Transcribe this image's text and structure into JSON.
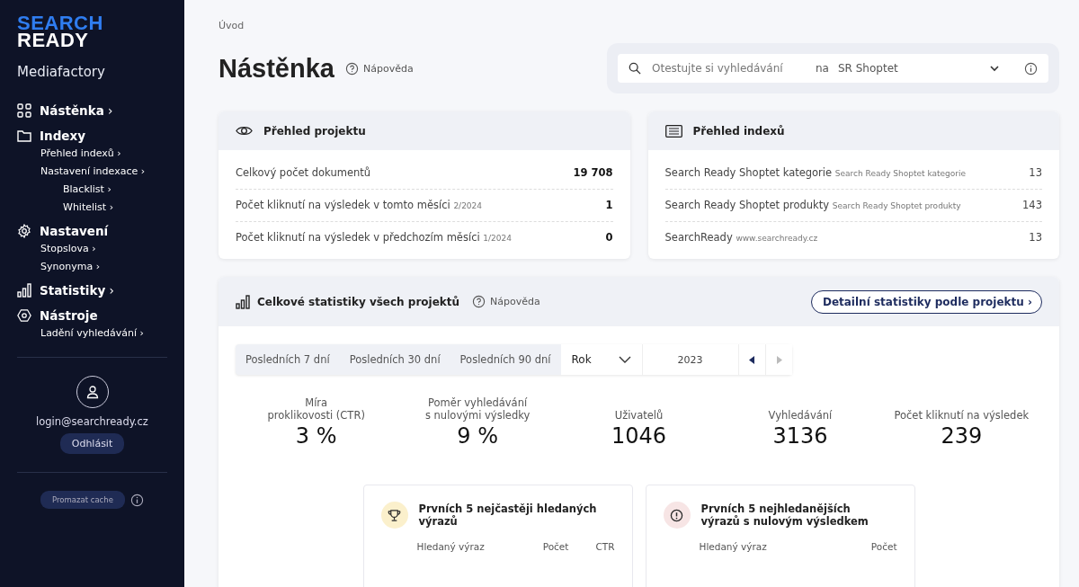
{
  "logo": {
    "line_1": "SEARCH",
    "line_2": "READY"
  },
  "sidebar": {
    "project": "Mediafactory",
    "sections": [
      {
        "kind": "grid",
        "label": "Nástěnka",
        "chevron": "›"
      },
      {
        "kind": "folder",
        "label": "Indexy",
        "children": [
          {
            "label": "Přehled indexů",
            "chevron": "›"
          },
          {
            "label": "Nastavení indexace",
            "chevron": "›",
            "children": [
              {
                "label": "Blacklist",
                "chevron": "›"
              },
              {
                "label": "Whitelist",
                "chevron": "›"
              }
            ]
          }
        ]
      },
      {
        "kind": "gear",
        "label": "Nastavení",
        "children": [
          {
            "label": "Stopslova",
            "chevron": "›"
          },
          {
            "label": "Synonyma",
            "chevron": "›"
          }
        ]
      },
      {
        "kind": "bars",
        "label": "Statistiky",
        "chevron": "›"
      },
      {
        "kind": "hexagon",
        "label": "Nástroje",
        "children": [
          {
            "label": "Ladění vyhledávání",
            "chevron": "›"
          }
        ]
      }
    ],
    "user": {
      "email": "login@searchready.cz",
      "logout": "Odhlásit"
    },
    "cache_button": "Promazat cache"
  },
  "breadcrumb": "Úvod",
  "title": "Nástěnka",
  "help": "Nápověda",
  "search": {
    "placeholder": "Otestujte si vyhledávání",
    "on": "na",
    "project": "SR Shoptet"
  },
  "project_overview": {
    "title": "Přehled projektu",
    "rows": [
      {
        "label": "Celkový počet dokumentů",
        "value": "19 708"
      },
      {
        "label": "Počet kliknutí na výsledek v tomto měsíci",
        "note": "2/2024",
        "value": "1"
      },
      {
        "label": "Počet kliknutí na výsledek v předchozím měsíci",
        "note": "1/2024",
        "value": "0"
      }
    ]
  },
  "index_overview": {
    "title": "Přehled indexů",
    "rows": [
      {
        "label": "Search Ready Shoptet kategorie",
        "note": "Search Ready Shoptet kategorie",
        "value": "13"
      },
      {
        "label": "Search Ready Shoptet produkty",
        "note": "Search Ready Shoptet produkty",
        "value": "143"
      },
      {
        "label": "SearchReady",
        "note": "www.searchready.cz",
        "value": "13"
      }
    ]
  },
  "statistics": {
    "title": "Celkové statistiky všech projektů",
    "help": "Nápověda",
    "detail_button": "Detailní statistiky podle projektu",
    "detail_chevron": "›",
    "ranges": [
      {
        "label": "Posledních 7 dní",
        "selected": false
      },
      {
        "label": "Posledních 30 dní",
        "selected": false
      },
      {
        "label": "Posledních 90 dní",
        "selected": false
      }
    ],
    "period": {
      "value": "Rok",
      "selected": true
    },
    "year": "2023",
    "metrics": [
      {
        "label": "Míra\nproklikovosti (CTR)",
        "value": "3 %"
      },
      {
        "label": "Poměr vyhledávání\ns nulovými výsledky",
        "value": "9 %"
      },
      {
        "label": "Uživatelů",
        "value": "1046"
      },
      {
        "label": "Vyhledávání",
        "value": "3136"
      },
      {
        "label": "Počet kliknutí na výsledek",
        "value": "239"
      }
    ],
    "top_cards": [
      {
        "kind": "trophy",
        "title": "Prvních 5 nejčastěji hledaných výrazů",
        "columns": [
          "Hledaný výraz",
          "Počet",
          "CTR"
        ]
      },
      {
        "kind": "alert",
        "title": "Prvních 5 nejhledanějších výrazů s nulovým výsledkem",
        "columns": [
          "Hledaný výraz",
          "Počet"
        ]
      }
    ]
  }
}
